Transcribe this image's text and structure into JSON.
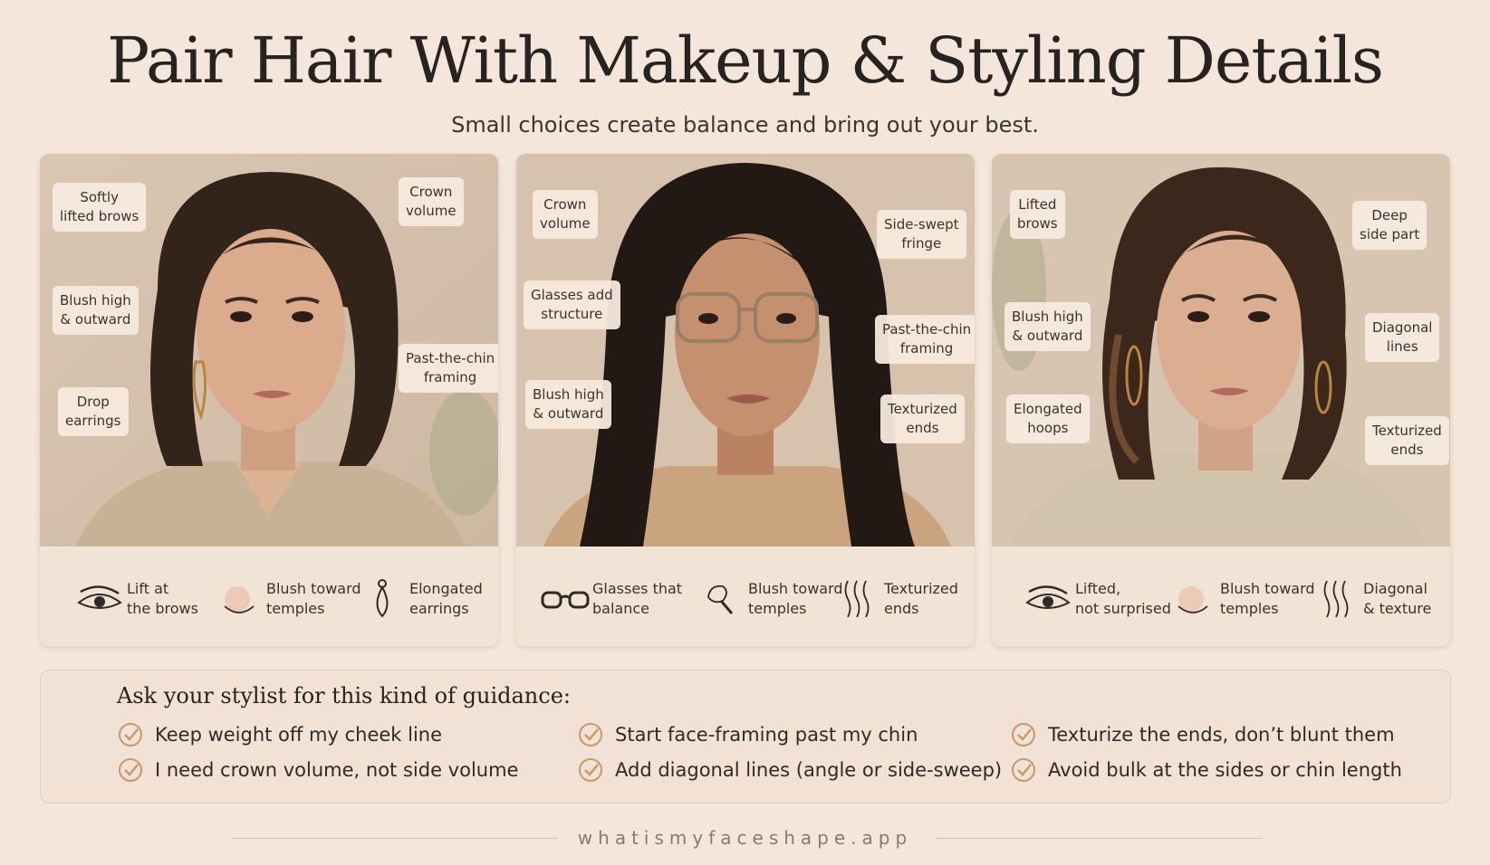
{
  "title": "Pair Hair With Makeup & Styling Details",
  "subtitle": "Small choices create balance and bring out your best.",
  "panels": [
    {
      "callouts": [
        [
          "Softly",
          "lifted brows"
        ],
        [
          "Crown",
          "volume"
        ],
        [
          "Blush high",
          "& outward"
        ],
        [
          "Past-the-chin",
          "framing"
        ],
        [
          "Drop",
          "earrings"
        ]
      ],
      "features": [
        {
          "icon": "eye-icon",
          "lines": [
            "Lift at",
            "the brows"
          ]
        },
        {
          "icon": "blush-icon",
          "lines": [
            "Blush toward",
            "temples"
          ]
        },
        {
          "icon": "earring-icon",
          "lines": [
            "Elongated",
            "earrings"
          ]
        }
      ]
    },
    {
      "callouts": [
        [
          "Crown",
          "volume"
        ],
        [
          "Side-swept",
          "fringe"
        ],
        [
          "Glasses add",
          "structure"
        ],
        [
          "Past-the-chin",
          "framing"
        ],
        [
          "Blush high",
          "& outward"
        ],
        [
          "Texturized",
          "ends"
        ]
      ],
      "features": [
        {
          "icon": "glasses-icon",
          "lines": [
            "Glasses that",
            "balance"
          ]
        },
        {
          "icon": "brush-icon",
          "lines": [
            "Blush toward",
            "temples"
          ]
        },
        {
          "icon": "waves-icon",
          "lines": [
            "Texturized",
            "ends"
          ]
        }
      ]
    },
    {
      "callouts": [
        [
          "Lifted",
          "brows"
        ],
        [
          "Deep",
          "side part"
        ],
        [
          "Blush high",
          "& outward"
        ],
        [
          "Diagonal",
          "lines"
        ],
        [
          "Elongated",
          "hoops"
        ],
        [
          "Texturized",
          "ends"
        ]
      ],
      "features": [
        {
          "icon": "eye-icon",
          "lines": [
            "Lifted,",
            "not surprised"
          ]
        },
        {
          "icon": "blush-icon",
          "lines": [
            "Blush toward",
            "temples"
          ]
        },
        {
          "icon": "waves-icon",
          "lines": [
            "Diagonal",
            "& texture"
          ]
        }
      ]
    }
  ],
  "guidance": {
    "title": "Ask your stylist for this kind of guidance:",
    "items": [
      "Keep weight off my cheek line",
      "I need crown volume, not side volume",
      "Start face-framing past my chin",
      "Add diagonal lines (angle or side-sweep)",
      "Texturize the ends, don’t blunt them",
      "Avoid bulk at the sides or chin length"
    ]
  },
  "footer": "whatismyfaceshape.app"
}
